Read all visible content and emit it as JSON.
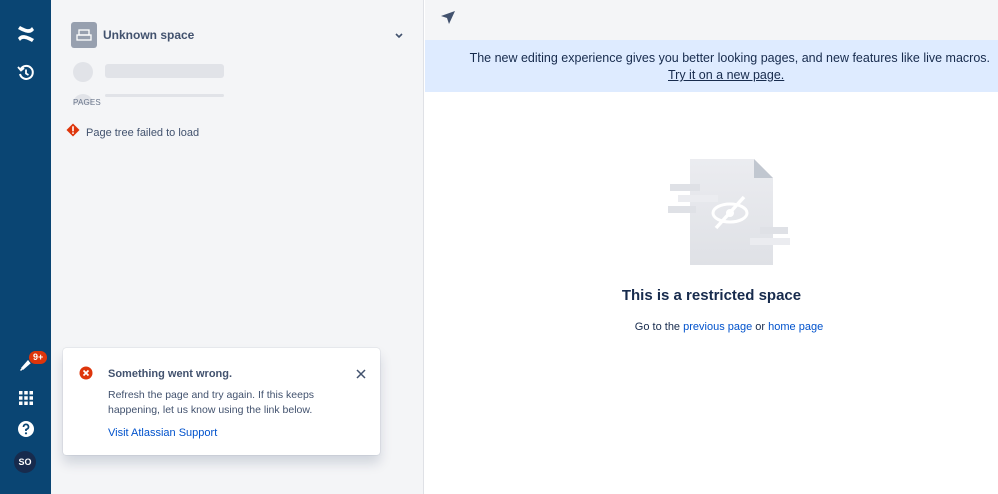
{
  "global_nav": {
    "notification_badge": "9+",
    "avatar_initials": "SO",
    "icons": [
      "confluence-logo-icon",
      "recent-history-icon",
      "notification-bell-icon",
      "app-switcher-icon",
      "help-icon"
    ]
  },
  "sidebar": {
    "space_name": "Unknown space",
    "pages_label": "PAGES",
    "tree_error": "Page tree failed to load"
  },
  "flag": {
    "title": "Something went wrong.",
    "body": "Refresh the page and try again. If this keeps happening, let us know using the link below.",
    "link": "Visit Atlassian Support"
  },
  "main": {
    "banner_text": "The new editing experience gives you better looking pages, and new features like live macros.",
    "banner_link": "Try it on a new page.",
    "title": "This is a restricted space",
    "sub_prefix": "Go to the",
    "sub_link1": "previous page",
    "sub_or": "or",
    "sub_link2": "home page"
  },
  "colors": {
    "nav_bg": "#0a4573",
    "sidebar_bg": "#f4f5f7",
    "banner_bg": "#deebff",
    "link": "#0052cc",
    "error": "#de350b"
  }
}
